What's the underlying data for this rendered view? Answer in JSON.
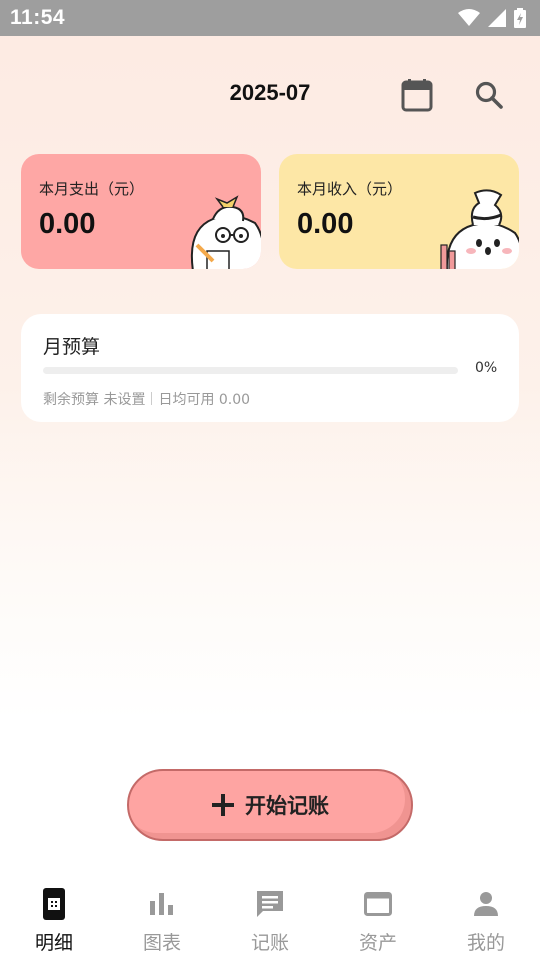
{
  "status_bar": {
    "time": "11:54"
  },
  "header": {
    "month": "2025-07",
    "calendar_icon": "calendar-icon",
    "search_icon": "search-icon"
  },
  "expense_card": {
    "label": "本月支出（元）",
    "value": "0.00",
    "color": "#fea7a5"
  },
  "income_card": {
    "label": "本月收入（元）",
    "value": "0.00",
    "color": "#fde7a6"
  },
  "budget": {
    "title": "月预算",
    "progress_percent": 0,
    "percent_label": "0%",
    "remaining_label": "剩余预算 未设置",
    "daily_label": "日均可用 0.00"
  },
  "fab": {
    "label": "开始记账",
    "icon": "plus-icon",
    "color": "#fea4a2"
  },
  "nav": {
    "items": [
      {
        "label": "明细",
        "icon": "detail-icon",
        "active": true
      },
      {
        "label": "图表",
        "icon": "bar-chart-icon",
        "active": false
      },
      {
        "label": "记账",
        "icon": "message-icon",
        "active": false
      },
      {
        "label": "资产",
        "icon": "wallet-icon",
        "active": false
      },
      {
        "label": "我的",
        "icon": "person-icon",
        "active": false
      }
    ]
  }
}
